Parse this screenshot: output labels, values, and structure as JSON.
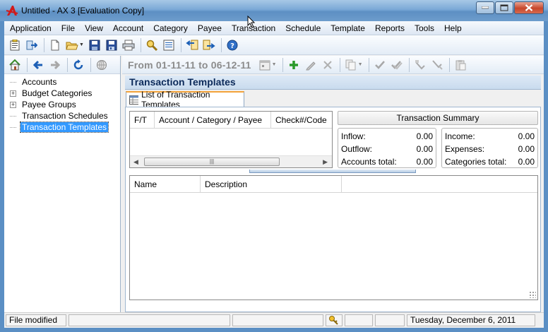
{
  "window": {
    "title": "Untitled - AX 3 [Evaluation Copy]"
  },
  "menu": [
    "Application",
    "File",
    "View",
    "Account",
    "Category",
    "Payee",
    "Transaction",
    "Schedule",
    "Template",
    "Reports",
    "Tools",
    "Help"
  ],
  "icons": {
    "app": "ax-logo-icon",
    "toolbar": [
      "properties-icon",
      "exit-icon",
      "new-file-icon",
      "open-folder-icon",
      "save-icon",
      "save-all-icon",
      "print-icon",
      "find-icon",
      "find-list-icon",
      "import-icon",
      "export-icon",
      "help-icon"
    ],
    "nav": [
      "home-icon",
      "back-icon",
      "forward-icon",
      "refresh-icon",
      "globe-icon"
    ],
    "transactions": [
      "calendar-icon",
      "add-icon",
      "edit-icon",
      "delete-icon",
      "copy-icon",
      "check-icon",
      "check-all-icon",
      "filter-icon",
      "filter-clear-icon",
      "paste-icon"
    ]
  },
  "tree": {
    "items": [
      {
        "label": "Accounts",
        "expandable": false,
        "selected": false
      },
      {
        "label": "Budget Categories",
        "expandable": true,
        "selected": false
      },
      {
        "label": "Payee Groups",
        "expandable": true,
        "selected": false
      },
      {
        "label": "Transaction Schedules",
        "expandable": false,
        "selected": false
      },
      {
        "label": "Transaction Templates",
        "expandable": false,
        "selected": true
      }
    ]
  },
  "date_range": "From 01-11-11 to 06-12-11",
  "section_title": "Transaction Templates",
  "tab_label": "List of Transaction Templates",
  "grid1": {
    "columns": [
      "F/T",
      "Account / Category / Payee",
      "Check#/Code"
    ]
  },
  "summary": {
    "title": "Transaction Summary",
    "left": [
      {
        "label": "Inflow:",
        "value": "0.00"
      },
      {
        "label": "Outflow:",
        "value": "0.00"
      },
      {
        "label": "Accounts total:",
        "value": "0.00"
      }
    ],
    "right": [
      {
        "label": "Income:",
        "value": "0.00"
      },
      {
        "label": "Expenses:",
        "value": "0.00"
      },
      {
        "label": "Categories total:",
        "value": "0.00"
      }
    ]
  },
  "grid2": {
    "columns": [
      "Name",
      "Description"
    ]
  },
  "status": {
    "message": "File modified",
    "date": "Tuesday, December 6, 2011"
  }
}
